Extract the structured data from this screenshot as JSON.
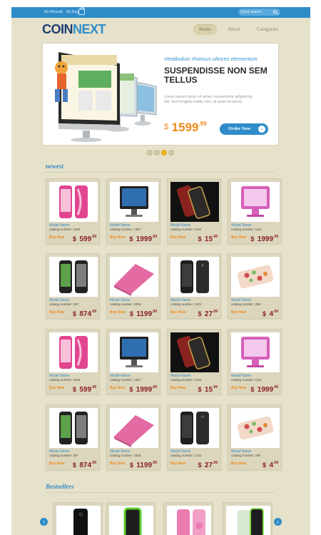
{
  "topbar": {
    "links": [
      "My Website",
      "My Bag"
    ],
    "search_placeholder": "Quick search..."
  },
  "header": {
    "logo_part1": "COIN",
    "logo_part2": "NEXT",
    "nav": [
      "Home",
      "About",
      "Categories"
    ],
    "active_nav": "Home"
  },
  "hero": {
    "subtitle": "Vestibulum rhoncus ultrices elementum",
    "title": "SUSPENDISSE NON SEM TELLUS",
    "description": "Lorem ipsum dolor sit amet, consectetur adipiscing elit. Sed fringilla mattis nisl, sit amet tincidunt.",
    "price_currency": "$",
    "price_int": "1599",
    "price_dec": ".99",
    "order_label": "Order Now",
    "order_icon": "chevron-right-icon"
  },
  "slider": {
    "slides": 4,
    "active": 3
  },
  "newest": {
    "title": "newest",
    "products": [
      {
        "name": "Model Name",
        "catalog": "catalog number: 1925",
        "buy": "Buy Now",
        "cur": "$",
        "int": "599",
        "dec": ".99",
        "icon": "pink-phone"
      },
      {
        "name": "Model Name",
        "catalog": "catalog number: 1357",
        "buy": "Buy Now",
        "cur": "$",
        "int": "1999",
        "dec": ".99",
        "icon": "black-monitor"
      },
      {
        "name": "Model Name",
        "catalog": "catalog number: 1264",
        "buy": "Buy Now",
        "cur": "$",
        "int": "15",
        "dec": ".99",
        "icon": "red-case"
      },
      {
        "name": "Model Name",
        "catalog": "catalog number: 1111",
        "buy": "Buy Now",
        "cur": "$",
        "int": "1999",
        "dec": ".99",
        "icon": "pink-monitor"
      },
      {
        "name": "Model Name",
        "catalog": "catalog number: 357",
        "buy": "Buy Now",
        "cur": "$",
        "int": "874",
        "dec": ".99",
        "icon": "phone-pair"
      },
      {
        "name": "Model Name",
        "catalog": "catalog number: 1926",
        "buy": "Buy Now",
        "cur": "$",
        "int": "1199",
        "dec": ".99",
        "icon": "pink-laptop"
      },
      {
        "name": "Model Name",
        "catalog": "catalog number: 1321",
        "buy": "Buy Now",
        "cur": "$",
        "int": "27",
        "dec": ".99",
        "icon": "black-case"
      },
      {
        "name": "Model Name",
        "catalog": "catalog number: 299",
        "buy": "Buy Now",
        "cur": "$",
        "int": "4",
        "dec": ".99",
        "icon": "floral-case"
      },
      {
        "name": "Model Name",
        "catalog": "catalog number: 1925",
        "buy": "Buy Now",
        "cur": "$",
        "int": "599",
        "dec": ".99",
        "icon": "pink-phone"
      },
      {
        "name": "Model Name",
        "catalog": "catalog number: 1357",
        "buy": "Buy Now",
        "cur": "$",
        "int": "1999",
        "dec": ".99",
        "icon": "black-monitor"
      },
      {
        "name": "Model Name",
        "catalog": "catalog number: 1264",
        "buy": "Buy Now",
        "cur": "$",
        "int": "15",
        "dec": ".99",
        "icon": "red-case"
      },
      {
        "name": "Model Name",
        "catalog": "catalog number: 1111",
        "buy": "Buy Now",
        "cur": "$",
        "int": "1999",
        "dec": ".99",
        "icon": "pink-monitor"
      },
      {
        "name": "Model Name",
        "catalog": "catalog number: 357",
        "buy": "Buy Now",
        "cur": "$",
        "int": "874",
        "dec": ".99",
        "icon": "phone-pair"
      },
      {
        "name": "Model Name",
        "catalog": "catalog number: 1926",
        "buy": "Buy Now",
        "cur": "$",
        "int": "1199",
        "dec": ".99",
        "icon": "pink-laptop"
      },
      {
        "name": "Model Name",
        "catalog": "catalog number: 1321",
        "buy": "Buy Now",
        "cur": "$",
        "int": "27",
        "dec": ".99",
        "icon": "black-case"
      },
      {
        "name": "Model Name",
        "catalog": "catalog number: 299",
        "buy": "Buy Now",
        "cur": "$",
        "int": "4",
        "dec": ".99",
        "icon": "floral-case"
      }
    ]
  },
  "bestsellers": {
    "title": "Bestsellers",
    "items": [
      {
        "icon": "black-phone"
      },
      {
        "icon": "green-phone"
      },
      {
        "icon": "pink-case"
      },
      {
        "icon": "green-case"
      }
    ],
    "prev_icon": "chevron-left-icon",
    "next_icon": "chevron-right-icon"
  },
  "colors": {
    "accent": "#2f8cc9",
    "price": "#8a1f25",
    "buy": "#f08a1c",
    "background": "#e6e1ca"
  }
}
